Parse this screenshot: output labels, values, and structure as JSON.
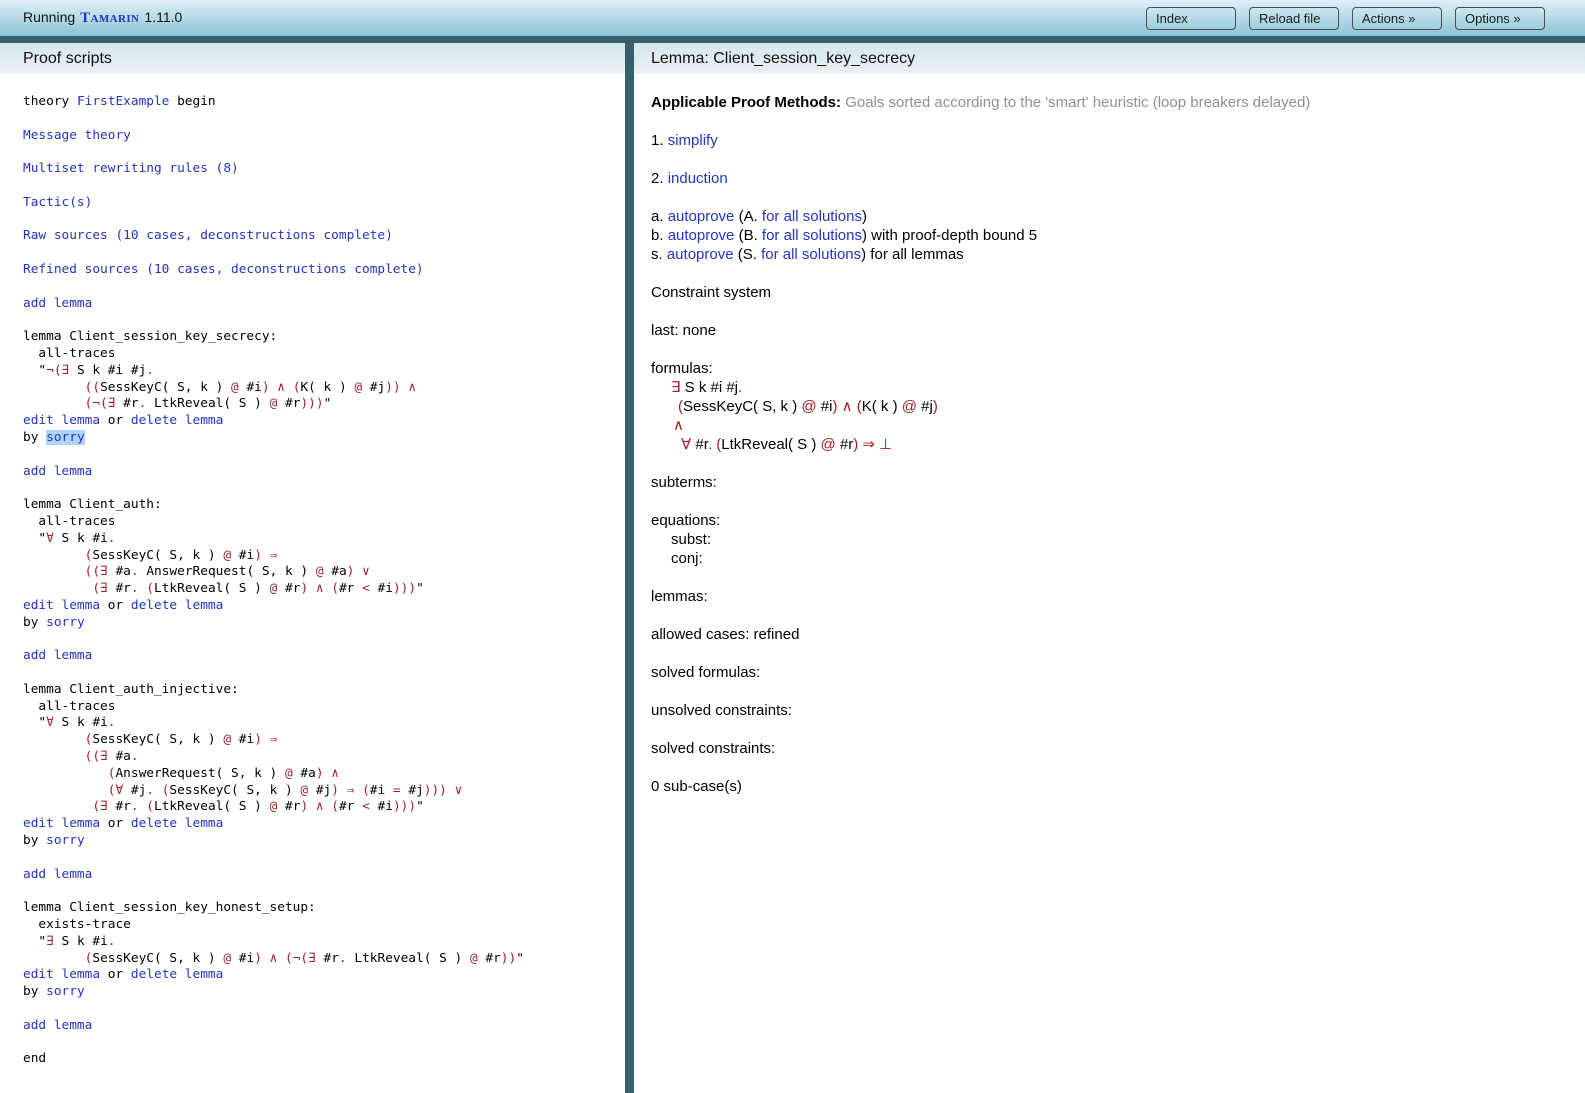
{
  "colors": {
    "link": "#2433c0",
    "op_red": "#9e2126",
    "muted": "#8f8f8f",
    "selection": "#b1d3f9",
    "divider": "#35606c",
    "topbar_top": "#ddf0f6",
    "topbar_bottom": "#8cc2d4",
    "panel_header": "#d4e6ec"
  },
  "topbar": {
    "running_prefix": "Running",
    "brand": "Tamarin",
    "version": "1.11.0",
    "buttons": [
      "Index",
      "Reload file",
      "Actions »",
      "Options »"
    ]
  },
  "left_panel": {
    "title": "Proof scripts",
    "lines": [
      {
        "seg": [
          [
            "theory "
          ],
          [
            "FirstExample",
            "a"
          ],
          [
            " begin"
          ]
        ]
      },
      {
        "seg": []
      },
      {
        "seg": [
          [
            "Message theory",
            "a"
          ]
        ]
      },
      {
        "seg": []
      },
      {
        "seg": [
          [
            "Multiset rewriting rules (8)",
            "a"
          ]
        ]
      },
      {
        "seg": []
      },
      {
        "seg": [
          [
            "Tactic(s)",
            "a"
          ]
        ]
      },
      {
        "seg": []
      },
      {
        "seg": [
          [
            "Raw sources (10 cases, deconstructions complete)",
            "a"
          ]
        ]
      },
      {
        "seg": []
      },
      {
        "seg": [
          [
            "Refined sources (10 cases, deconstructions complete)",
            "a"
          ]
        ]
      },
      {
        "seg": []
      },
      {
        "seg": [
          [
            "add lemma",
            "a"
          ]
        ]
      },
      {
        "seg": []
      },
      {
        "seg": [
          [
            "lemma Client_session_key_secrecy:"
          ]
        ]
      },
      {
        "seg": [
          [
            "  all-traces"
          ]
        ]
      },
      {
        "seg": [
          [
            "  \""
          ],
          [
            "¬(∃",
            "r"
          ],
          [
            " S k #i #j"
          ],
          [
            ".",
            "r"
          ]
        ]
      },
      {
        "seg": [
          [
            "        "
          ],
          [
            "((",
            "r"
          ],
          [
            "SessKeyC( S, k )"
          ],
          [
            " @ ",
            "r"
          ],
          [
            "#i"
          ],
          [
            ") ∧ (",
            "r"
          ],
          [
            "K( k )"
          ],
          [
            " @ ",
            "r"
          ],
          [
            "#j"
          ],
          [
            ")) ∧",
            "r"
          ]
        ]
      },
      {
        "seg": [
          [
            "        "
          ],
          [
            "(¬(∃",
            "r"
          ],
          [
            " #r"
          ],
          [
            ". ",
            "r"
          ],
          [
            "LtkReveal( S )"
          ],
          [
            " @ ",
            "r"
          ],
          [
            "#r"
          ],
          [
            ")))",
            "r"
          ],
          [
            "\""
          ]
        ]
      },
      {
        "seg": [
          [
            "edit lemma",
            "a"
          ],
          [
            " or "
          ],
          [
            "delete lemma",
            "a"
          ]
        ]
      },
      {
        "seg": [
          [
            "by "
          ],
          [
            "sorry",
            "hl"
          ]
        ]
      },
      {
        "seg": []
      },
      {
        "seg": [
          [
            "add lemma",
            "a"
          ]
        ]
      },
      {
        "seg": []
      },
      {
        "seg": [
          [
            "lemma Client_auth:"
          ]
        ]
      },
      {
        "seg": [
          [
            "  all-traces"
          ]
        ]
      },
      {
        "seg": [
          [
            "  \""
          ],
          [
            "∀",
            "r"
          ],
          [
            " S k #i"
          ],
          [
            ".",
            "r"
          ]
        ]
      },
      {
        "seg": [
          [
            "        "
          ],
          [
            "(",
            "r"
          ],
          [
            "SessKeyC( S, k )"
          ],
          [
            " @ ",
            "r"
          ],
          [
            "#i"
          ],
          [
            ") ⇒",
            "r"
          ]
        ]
      },
      {
        "seg": [
          [
            "        "
          ],
          [
            "((∃",
            "r"
          ],
          [
            " #a"
          ],
          [
            ". ",
            "r"
          ],
          [
            "AnswerRequest( S, k )"
          ],
          [
            " @ ",
            "r"
          ],
          [
            "#a"
          ],
          [
            ") ∨",
            "r"
          ]
        ]
      },
      {
        "seg": [
          [
            "         "
          ],
          [
            "(∃",
            "r"
          ],
          [
            " #r"
          ],
          [
            ". (",
            "r"
          ],
          [
            "LtkReveal( S )"
          ],
          [
            " @ ",
            "r"
          ],
          [
            "#r"
          ],
          [
            ") ∧ (",
            "r"
          ],
          [
            "#r"
          ],
          [
            " < ",
            "r"
          ],
          [
            "#i"
          ],
          [
            ")))",
            "r"
          ],
          [
            "\""
          ]
        ]
      },
      {
        "seg": [
          [
            "edit lemma",
            "a"
          ],
          [
            " or "
          ],
          [
            "delete lemma",
            "a"
          ]
        ]
      },
      {
        "seg": [
          [
            "by "
          ],
          [
            "sorry",
            "a"
          ]
        ]
      },
      {
        "seg": []
      },
      {
        "seg": [
          [
            "add lemma",
            "a"
          ]
        ]
      },
      {
        "seg": []
      },
      {
        "seg": [
          [
            "lemma Client_auth_injective:"
          ]
        ]
      },
      {
        "seg": [
          [
            "  all-traces"
          ]
        ]
      },
      {
        "seg": [
          [
            "  \""
          ],
          [
            "∀",
            "r"
          ],
          [
            " S k #i"
          ],
          [
            ".",
            "r"
          ]
        ]
      },
      {
        "seg": [
          [
            "        "
          ],
          [
            "(",
            "r"
          ],
          [
            "SessKeyC( S, k )"
          ],
          [
            " @ ",
            "r"
          ],
          [
            "#i"
          ],
          [
            ") ⇒",
            "r"
          ]
        ]
      },
      {
        "seg": [
          [
            "        "
          ],
          [
            "((∃",
            "r"
          ],
          [
            " #a"
          ],
          [
            ".",
            "r"
          ]
        ]
      },
      {
        "seg": [
          [
            "           "
          ],
          [
            "(",
            "r"
          ],
          [
            "AnswerRequest( S, k )"
          ],
          [
            " @ ",
            "r"
          ],
          [
            "#a"
          ],
          [
            ") ∧",
            "r"
          ]
        ]
      },
      {
        "seg": [
          [
            "           "
          ],
          [
            "(∀",
            "r"
          ],
          [
            " #j"
          ],
          [
            ". (",
            "r"
          ],
          [
            "SessKeyC( S, k )"
          ],
          [
            " @ ",
            "r"
          ],
          [
            "#j"
          ],
          [
            ") ⇒ (",
            "r"
          ],
          [
            "#i"
          ],
          [
            " = ",
            "r"
          ],
          [
            "#j"
          ],
          [
            "))) ∨",
            "r"
          ]
        ]
      },
      {
        "seg": [
          [
            "         "
          ],
          [
            "(∃",
            "r"
          ],
          [
            " #r"
          ],
          [
            ". (",
            "r"
          ],
          [
            "LtkReveal( S )"
          ],
          [
            " @ ",
            "r"
          ],
          [
            "#r"
          ],
          [
            ") ∧ (",
            "r"
          ],
          [
            "#r"
          ],
          [
            " < ",
            "r"
          ],
          [
            "#i"
          ],
          [
            ")))",
            "r"
          ],
          [
            "\""
          ]
        ]
      },
      {
        "seg": [
          [
            "edit lemma",
            "a"
          ],
          [
            " or "
          ],
          [
            "delete lemma",
            "a"
          ]
        ]
      },
      {
        "seg": [
          [
            "by "
          ],
          [
            "sorry",
            "a"
          ]
        ]
      },
      {
        "seg": []
      },
      {
        "seg": [
          [
            "add lemma",
            "a"
          ]
        ]
      },
      {
        "seg": []
      },
      {
        "seg": [
          [
            "lemma Client_session_key_honest_setup:"
          ]
        ]
      },
      {
        "seg": [
          [
            "  exists-trace"
          ]
        ]
      },
      {
        "seg": [
          [
            "  \""
          ],
          [
            "∃",
            "r"
          ],
          [
            " S k #i"
          ],
          [
            ".",
            "r"
          ]
        ]
      },
      {
        "seg": [
          [
            "        "
          ],
          [
            "(",
            "r"
          ],
          [
            "SessKeyC( S, k )"
          ],
          [
            " @ ",
            "r"
          ],
          [
            "#i"
          ],
          [
            ") ∧ (¬(∃",
            "r"
          ],
          [
            " #r"
          ],
          [
            ". ",
            "r"
          ],
          [
            "LtkReveal( S )"
          ],
          [
            " @ ",
            "r"
          ],
          [
            "#r"
          ],
          [
            "))",
            "r"
          ],
          [
            "\""
          ]
        ]
      },
      {
        "seg": [
          [
            "edit lemma",
            "a"
          ],
          [
            " or "
          ],
          [
            "delete lemma",
            "a"
          ]
        ]
      },
      {
        "seg": [
          [
            "by "
          ],
          [
            "sorry",
            "a"
          ]
        ]
      },
      {
        "seg": []
      },
      {
        "seg": [
          [
            "add lemma",
            "a"
          ]
        ]
      },
      {
        "seg": []
      },
      {
        "seg": [
          [
            "end"
          ]
        ]
      }
    ]
  },
  "right_panel": {
    "title": "Lemma: Client_session_key_secrecy",
    "lines": [
      {
        "seg": [
          [
            "Applicable Proof Methods: ",
            "b"
          ],
          [
            "Goals sorted according to the 'smart' heuristic (loop breakers delayed)",
            "g"
          ]
        ]
      },
      {
        "seg": []
      },
      {
        "seg": [
          [
            "1. "
          ],
          [
            "simplify",
            "a"
          ]
        ]
      },
      {
        "seg": []
      },
      {
        "seg": [
          [
            "2. "
          ],
          [
            "induction",
            "a"
          ]
        ]
      },
      {
        "seg": []
      },
      {
        "seg": [
          [
            "a. "
          ],
          [
            "autoprove",
            "a"
          ],
          [
            " (A. "
          ],
          [
            "for all solutions",
            "a"
          ],
          [
            ")"
          ]
        ]
      },
      {
        "seg": [
          [
            "b. "
          ],
          [
            "autoprove",
            "a"
          ],
          [
            " (B. "
          ],
          [
            "for all solutions",
            "a"
          ],
          [
            ") with proof-depth bound 5"
          ]
        ]
      },
      {
        "seg": [
          [
            "s. "
          ],
          [
            "autoprove",
            "a"
          ],
          [
            " (S. "
          ],
          [
            "for all solutions",
            "a"
          ],
          [
            ") for all lemmas"
          ]
        ]
      },
      {
        "seg": []
      },
      {
        "seg": [
          [
            "Constraint system"
          ]
        ]
      },
      {
        "seg": []
      },
      {
        "seg": [
          [
            "last: none"
          ]
        ]
      },
      {
        "seg": []
      },
      {
        "seg": [
          [
            "formulas:"
          ]
        ]
      },
      {
        "ind": 20,
        "seg": [
          [
            "∃",
            "r"
          ],
          [
            " S k #i #j"
          ],
          [
            ".",
            "r"
          ]
        ]
      },
      {
        "ind": 27,
        "seg": [
          [
            "(",
            "r"
          ],
          [
            "SessKeyC( S, k )"
          ],
          [
            " @ ",
            "r"
          ],
          [
            "#i"
          ],
          [
            ") ∧ (",
            "r"
          ],
          [
            "K( k )"
          ],
          [
            " @ ",
            "r"
          ],
          [
            "#j"
          ],
          [
            ")",
            "r"
          ]
        ]
      },
      {
        "ind": 22,
        "seg": [
          [
            "∧",
            "r"
          ]
        ]
      },
      {
        "ind": 30,
        "seg": [
          [
            "∀",
            "r"
          ],
          [
            " #r"
          ],
          [
            ". (",
            "r"
          ],
          [
            "LtkReveal( S )"
          ],
          [
            " @ ",
            "r"
          ],
          [
            "#r"
          ],
          [
            ") ⇒ ⊥",
            "r"
          ]
        ]
      },
      {
        "seg": []
      },
      {
        "seg": [
          [
            "subterms:"
          ]
        ]
      },
      {
        "seg": []
      },
      {
        "seg": [
          [
            "equations:"
          ]
        ]
      },
      {
        "ind": 20,
        "seg": [
          [
            "subst:"
          ]
        ]
      },
      {
        "ind": 20,
        "seg": [
          [
            "conj:"
          ]
        ]
      },
      {
        "seg": []
      },
      {
        "seg": [
          [
            "lemmas:"
          ]
        ]
      },
      {
        "seg": []
      },
      {
        "seg": [
          [
            "allowed cases: refined"
          ]
        ]
      },
      {
        "seg": []
      },
      {
        "seg": [
          [
            "solved formulas:"
          ]
        ]
      },
      {
        "seg": []
      },
      {
        "seg": [
          [
            "unsolved constraints:"
          ]
        ]
      },
      {
        "seg": []
      },
      {
        "seg": [
          [
            "solved constraints:"
          ]
        ]
      },
      {
        "seg": []
      },
      {
        "seg": [
          [
            "0 sub-case(s)"
          ]
        ]
      }
    ]
  }
}
